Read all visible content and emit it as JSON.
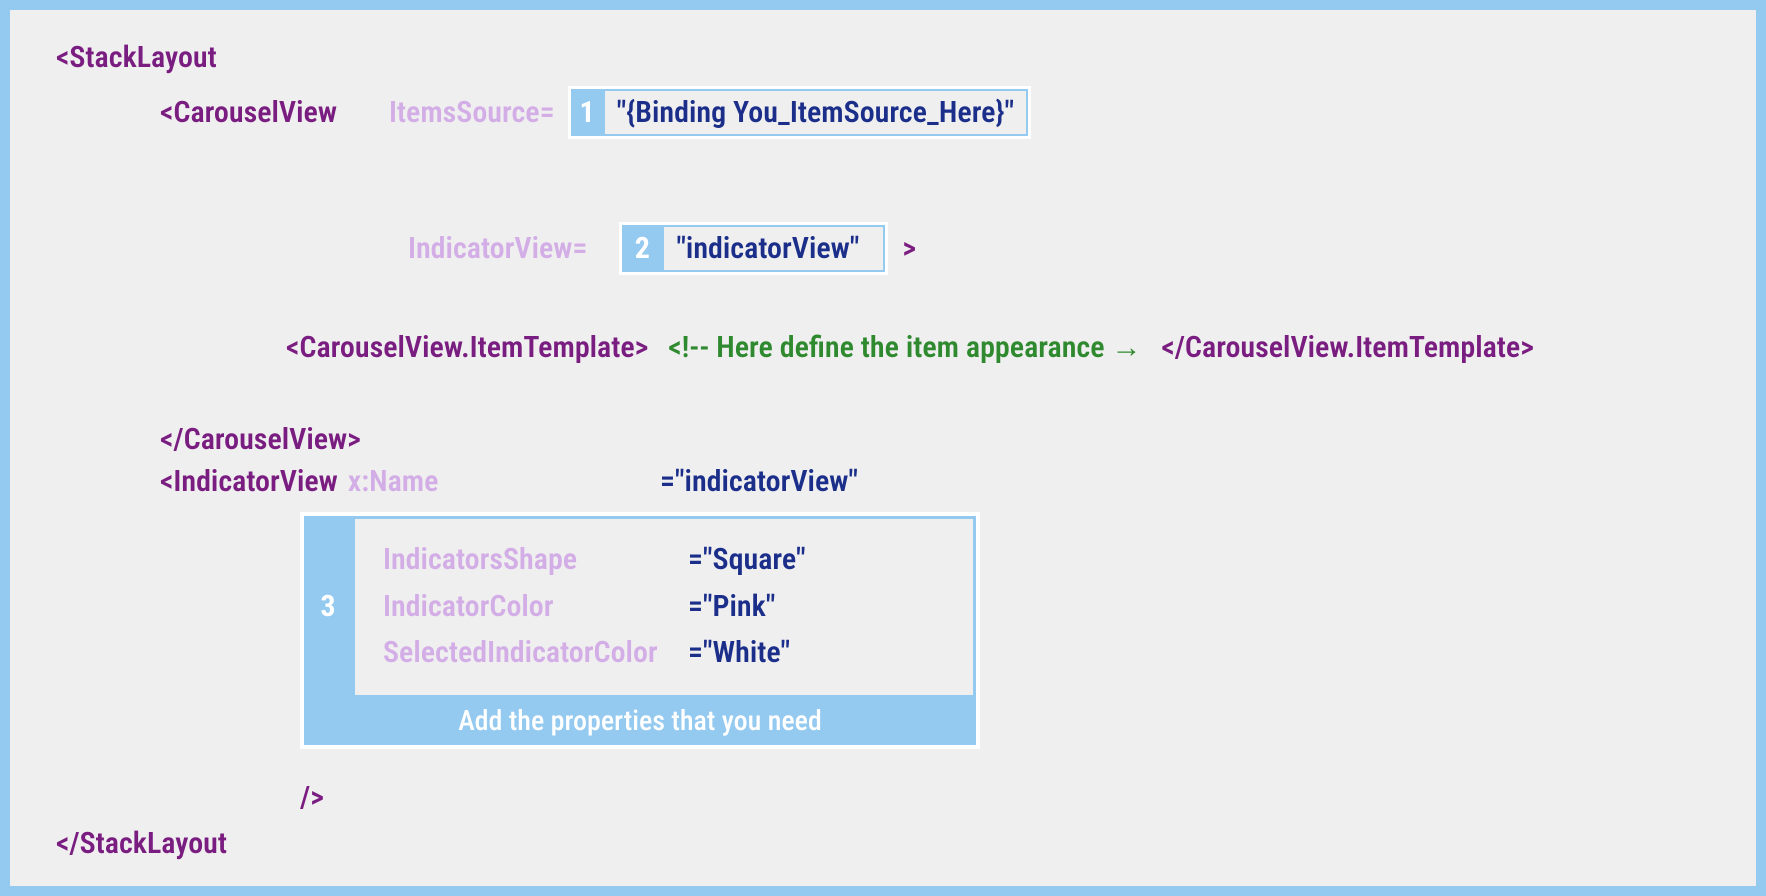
{
  "line1": {
    "stacklayout_open": "<StackLayout"
  },
  "line2": {
    "carouselview_open": "<CarouselView",
    "items_source_label": "ItemsSource=",
    "box1_num": "1",
    "box1_value": "\"{Binding You_ItemSource_Here}\""
  },
  "line3": {
    "indicator_view_label": "IndicatorView=",
    "box2_num": "2",
    "box2_value": "\"indicatorView\"",
    "gt": ">"
  },
  "line4": {
    "open_tag": "<CarouselView.ItemTemplate>",
    "comment": "<!-- Here define the item appearance →",
    "close_tag": "</CarouselView.ItemTemplate>"
  },
  "line5": {
    "carouselview_close": "</CarouselView>"
  },
  "line6": {
    "indicatorview_open": "<IndicatorView",
    "xname_label": "x:Name",
    "xname_eq": "=",
    "xname_value": "\"indicatorView\""
  },
  "props": {
    "num": "3",
    "rows": [
      {
        "name": "IndicatorsShape",
        "eq": "=",
        "value": "\"Square\""
      },
      {
        "name": "IndicatorColor",
        "eq": "=",
        "value": "\"Pink\""
      },
      {
        "name": "SelectedIndicatorColor",
        "eq": " =",
        "value": "\"White\""
      }
    ],
    "caption": "Add the properties that you need"
  },
  "line_end": {
    "self_close": "/>"
  },
  "line_last": {
    "stacklayout_close": "</StackLayout"
  }
}
